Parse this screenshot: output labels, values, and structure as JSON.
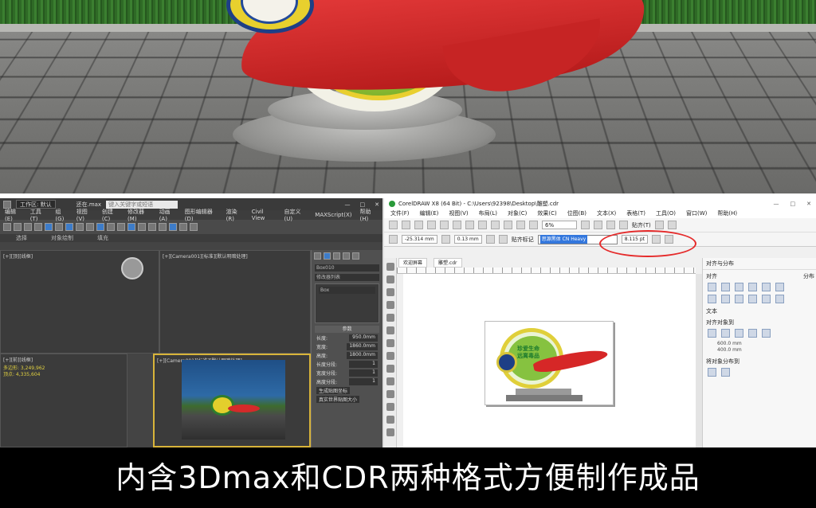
{
  "max": {
    "workspace": "工作区: 默认",
    "filename": "还在.max",
    "search_placeholder": "键入关键字或短语",
    "menu": [
      "编辑(E)",
      "工具(T)",
      "组(G)",
      "视图(V)",
      "创建(C)",
      "修改器(M)",
      "动画(A)",
      "图形编辑器(D)",
      "渲染(R)",
      "Civil View",
      "自定义(U)",
      "MAXScript(X)",
      "帮助(H)"
    ],
    "ribbon": [
      "选择",
      "对象绘制",
      "填充"
    ],
    "viewport_labels": [
      "[+][顶][线框]",
      "[+][Camera001][标准][默认明暗处理]",
      "[+][前][线框]",
      "[+][Camera001][标准][默认明暗处理]"
    ],
    "stats": [
      "多边形: 3,249,962",
      "顶点: 4,335,604"
    ],
    "command_panel": {
      "object_name": "Box010",
      "modifier_list": "修改器列表",
      "stack_item": "Box",
      "params_title": "参数",
      "params": [
        {
          "label": "长度:",
          "value": "950.0mm"
        },
        {
          "label": "宽度:",
          "value": "1860.0mm"
        },
        {
          "label": "高度:",
          "value": "1800.0mm"
        },
        {
          "label": "长度分段:",
          "value": "1"
        },
        {
          "label": "宽度分段:",
          "value": "1"
        },
        {
          "label": "高度分段:",
          "value": "1"
        }
      ],
      "checkbox_1": "生成贴图坐标",
      "checkbox_2": "真实世界贴图大小"
    }
  },
  "cdr": {
    "title": "CorelDRAW X8 (64 Bit) - C:\\Users\\92398\\Desktop\\雕塑.cdr",
    "menu": [
      "文件(F)",
      "编辑(E)",
      "视图(V)",
      "布局(L)",
      "对象(C)",
      "效果(C)",
      "位图(B)",
      "文本(X)",
      "表格(T)",
      "工具(O)",
      "窗口(W)",
      "帮助(H)"
    ],
    "zoom": "6%",
    "snap_label": "贴齐(T)",
    "prop_x": "-25.314 mm",
    "prop_w": "0.13 mm",
    "snap_to": "贴齐标记",
    "font_name": "思源黑体 CN Heavy",
    "font_size": "8.115 pt",
    "doc_tabs": [
      "欢迎屏幕",
      "雕塑.cdr"
    ],
    "page_text": [
      "珍爱生命",
      "远离毒品"
    ],
    "dock": {
      "title": "对齐与分布",
      "align": "对齐",
      "distribute": "分布",
      "text": "文本",
      "align_to": "对齐对象到",
      "width_value": "600.0 mm",
      "height_value": "400.0 mm",
      "distribute_to": "将对象分布到"
    }
  },
  "caption": "内含3Dmax和CDR两种格式方便制作成品"
}
